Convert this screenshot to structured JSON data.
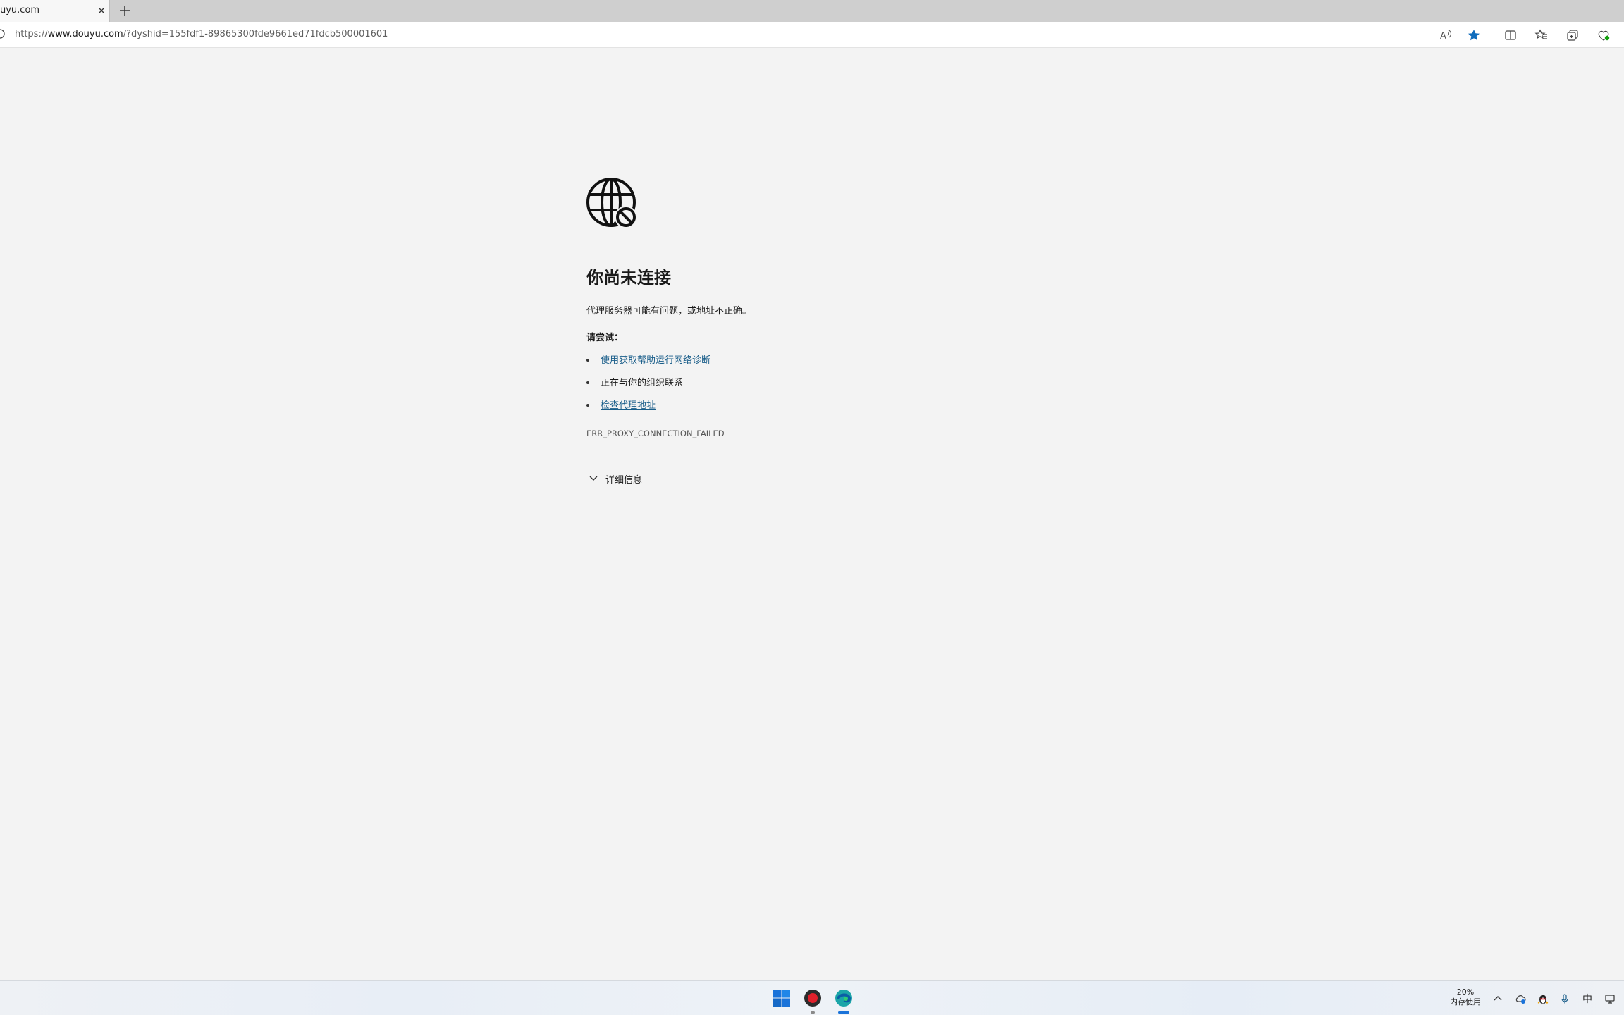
{
  "tab": {
    "title": "uyu.com"
  },
  "address_bar": {
    "scheme": "https://",
    "host": "www.douyu.com",
    "path": "/?dyshid=155fdf1-89865300fde9661ed71fdcb500001601"
  },
  "error_page": {
    "title": "你尚未连接",
    "description": "代理服务器可能有问题，或地址不正确。",
    "try_label": "请尝试：",
    "suggestions": [
      {
        "text": "使用获取帮助运行网络诊断",
        "link": true
      },
      {
        "text": "正在与你的组织联系",
        "link": false
      },
      {
        "text": "检查代理地址",
        "link": true
      }
    ],
    "error_code": "ERR_PROXY_CONNECTION_FAILED",
    "details_label": "详细信息"
  },
  "taskbar": {
    "memory_percent": "20%",
    "memory_label": "内存使用",
    "ime_indicator": "中"
  },
  "colors": {
    "page_background": "#f3f3f3",
    "link": "#1a5e8a",
    "favorite_star": "#0f6cbd",
    "edge_teal": "#1ba5a8"
  },
  "icons": {
    "error": "globe-blocked-icon",
    "toolbar": [
      "read-aloud-icon",
      "favorite-star-icon",
      "split-screen-icon",
      "favorites-icon",
      "collections-icon",
      "browser-essentials-icon"
    ],
    "taskbar": [
      "windows-start-icon",
      "recorder-app-icon",
      "edge-browser-icon"
    ],
    "tray": [
      "chevron-up-icon",
      "cloud-sync-icon",
      "qq-penguin-icon",
      "microphone-icon",
      "network-icon"
    ]
  }
}
